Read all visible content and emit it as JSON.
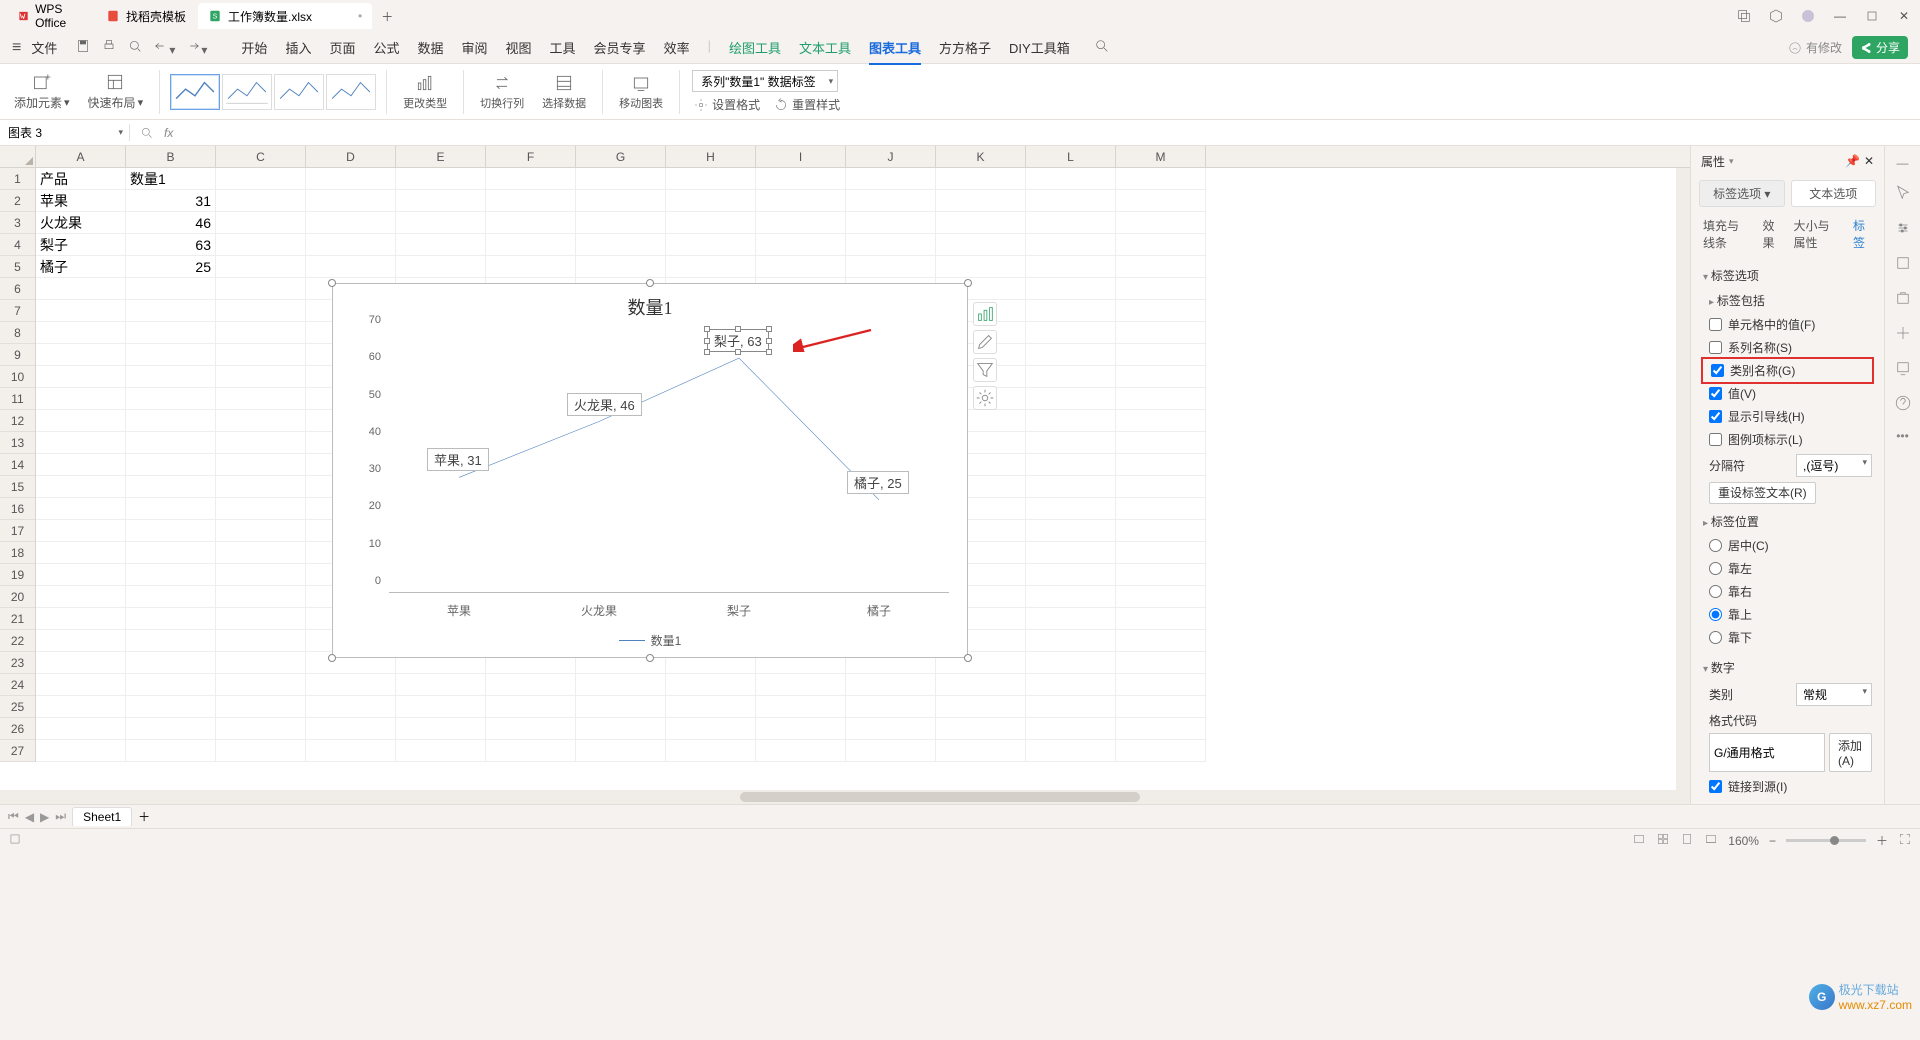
{
  "app": {
    "name": "WPS Office"
  },
  "tabs": [
    {
      "label": "找稻壳模板",
      "icon": "doc"
    },
    {
      "label": "工作簿数量.xlsx",
      "icon": "sheet",
      "active": true
    }
  ],
  "menu": {
    "file": "文件",
    "items": [
      "开始",
      "插入",
      "页面",
      "公式",
      "数据",
      "审阅",
      "视图",
      "工具",
      "会员专享",
      "效率"
    ],
    "tool_items": [
      "绘图工具",
      "文本工具",
      "图表工具",
      "方方格子",
      "DIY工具箱"
    ],
    "active_tool": "图表工具",
    "has_mod": "有修改",
    "share": "分享"
  },
  "ribbon": {
    "add_elem": "添加元素",
    "quick_layout": "快速布局",
    "change_type": "更改类型",
    "switch_rc": "切换行列",
    "select_data": "选择数据",
    "move_chart": "移动图表",
    "series_combo": "系列\"数量1\" 数据标签",
    "fmt": "设置格式",
    "reset": "重置样式"
  },
  "namebox": "图表 3",
  "cols": [
    "A",
    "B",
    "C",
    "D",
    "E",
    "F",
    "G",
    "H",
    "I",
    "J",
    "K",
    "L",
    "M"
  ],
  "rows": 27,
  "table": {
    "headers": [
      "产品",
      "数量1"
    ],
    "rows": [
      [
        "苹果",
        31
      ],
      [
        "火龙果",
        46
      ],
      [
        "梨子",
        63
      ],
      [
        "橘子",
        25
      ]
    ]
  },
  "chart_data": {
    "type": "line",
    "title": "数量1",
    "categories": [
      "苹果",
      "火龙果",
      "梨子",
      "橘子"
    ],
    "series": [
      {
        "name": "数量1",
        "values": [
          31,
          46,
          63,
          25
        ]
      }
    ],
    "ylim": [
      0,
      70
    ],
    "ystep": 10,
    "data_labels": [
      "苹果, 31",
      "火龙果, 46",
      "梨子, 63",
      "橘子, 25"
    ]
  },
  "panel": {
    "title": "属性",
    "tabs": {
      "label_opt": "标签选项",
      "text_opt": "文本选项"
    },
    "subtabs": [
      "填充与线条",
      "效果",
      "大小与属性",
      "标签"
    ],
    "active_sub": "标签",
    "sect_label_opt": "标签选项",
    "label_includes": "标签包括",
    "chk_cellval": "单元格中的值(F)",
    "chk_series": "系列名称(S)",
    "chk_cat": "类别名称(G)",
    "chk_val": "值(V)",
    "chk_leader": "显示引导线(H)",
    "chk_legendkey": "图例项标示(L)",
    "separator": "分隔符",
    "separator_val": ",(逗号)",
    "reset_text": "重设标签文本(R)",
    "sect_pos": "标签位置",
    "pos_center": "居中(C)",
    "pos_left": "靠左",
    "pos_right": "靠右",
    "pos_top": "靠上",
    "pos_bottom": "靠下",
    "sect_num": "数字",
    "num_cat": "类别",
    "num_cat_val": "常规",
    "num_fmt": "格式代码",
    "num_fmt_val": "G/通用格式",
    "num_add": "添加(A)",
    "link_src": "链接到源(I)"
  },
  "sheet_tab": "Sheet1",
  "status": {
    "zoom": "160%"
  },
  "watermark": {
    "t1": "极光下载站",
    "t2": "www.xz7.com"
  }
}
